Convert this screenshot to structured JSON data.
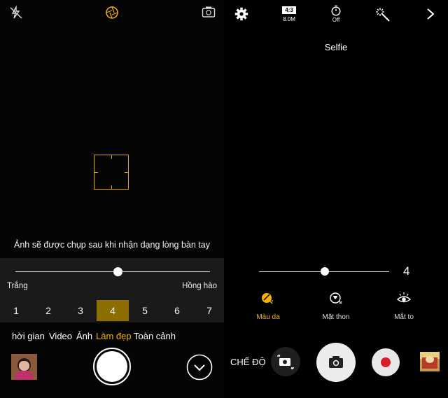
{
  "left": {
    "hint_text": "Ảnh sẽ được chụp sau khi nhận dạng lòng bàn tay",
    "slider": {
      "min_label": "Trắng",
      "max_label": "Hồng hào",
      "value_fraction": 0.5
    },
    "levels": [
      "1",
      "2",
      "3",
      "4",
      "5",
      "6",
      "7"
    ],
    "selected_level": "4",
    "modes": [
      {
        "label": "hời gian",
        "active": false
      },
      {
        "label": "Video",
        "active": false
      },
      {
        "label": "Ảnh",
        "active": false
      },
      {
        "label": "Làm đẹp",
        "active": true
      },
      {
        "label": "Toàn cảnh",
        "active": false
      }
    ],
    "icons": {
      "flash": "flash-off-icon",
      "beauty": "aperture-icon",
      "switch": "switch-camera-icon",
      "expand": "chevron-down-icon"
    }
  },
  "right": {
    "ratio": {
      "top": "4:3",
      "bottom": "8.0M"
    },
    "timer": "Off",
    "mode_title": "Selfie",
    "slider_value": "4",
    "slider_fraction": 0.5,
    "options": [
      {
        "label": "Màu da",
        "active": true,
        "icon": "skin-tone-icon"
      },
      {
        "label": "Mặt thon",
        "active": false,
        "icon": "slim-face-icon"
      },
      {
        "label": "Mắt to",
        "active": false,
        "icon": "big-eyes-icon"
      }
    ],
    "mode_button": "CHẾ ĐỘ"
  },
  "colors": {
    "accent": "#f5b400",
    "selected_level_bg": "#8c6f00",
    "record_red": "#d91e2a"
  }
}
